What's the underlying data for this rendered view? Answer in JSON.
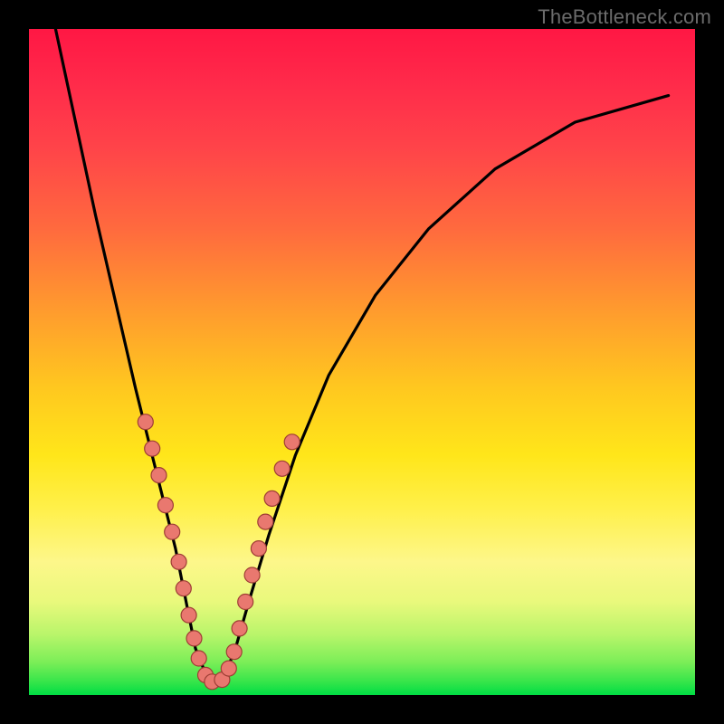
{
  "watermark": "TheBottleneck.com",
  "colors": {
    "frame": "#000000",
    "dot_fill": "#e9786f",
    "dot_stroke": "#9e3e35",
    "curve": "#000000"
  },
  "chart_data": {
    "type": "line",
    "title": "",
    "xlabel": "",
    "ylabel": "",
    "xlim": [
      0,
      100
    ],
    "ylim": [
      0,
      100
    ],
    "grid": false,
    "legend": false,
    "note": "V-shaped bottleneck curve; minimum near x≈27; dots mark sampled points along lower portion of curve",
    "series": [
      {
        "name": "curve",
        "x": [
          4,
          7,
          10,
          13,
          16,
          19,
          22,
          24,
          25,
          27,
          29,
          31,
          33,
          36,
          40,
          45,
          52,
          60,
          70,
          82,
          96
        ],
        "y": [
          100,
          86,
          72,
          59,
          46,
          34,
          22,
          12,
          7,
          2,
          2,
          7,
          14,
          24,
          36,
          48,
          60,
          70,
          79,
          86,
          90
        ]
      }
    ],
    "dots": [
      {
        "x": 17.5,
        "y": 41
      },
      {
        "x": 18.5,
        "y": 37
      },
      {
        "x": 19.5,
        "y": 33
      },
      {
        "x": 20.5,
        "y": 28.5
      },
      {
        "x": 21.5,
        "y": 24.5
      },
      {
        "x": 22.5,
        "y": 20
      },
      {
        "x": 23.2,
        "y": 16
      },
      {
        "x": 24.0,
        "y": 12
      },
      {
        "x": 24.8,
        "y": 8.5
      },
      {
        "x": 25.5,
        "y": 5.5
      },
      {
        "x": 26.5,
        "y": 3
      },
      {
        "x": 27.5,
        "y": 2
      },
      {
        "x": 29.0,
        "y": 2.3
      },
      {
        "x": 30.0,
        "y": 4
      },
      {
        "x": 30.8,
        "y": 6.5
      },
      {
        "x": 31.6,
        "y": 10
      },
      {
        "x": 32.5,
        "y": 14
      },
      {
        "x": 33.5,
        "y": 18
      },
      {
        "x": 34.5,
        "y": 22
      },
      {
        "x": 35.5,
        "y": 26
      },
      {
        "x": 36.5,
        "y": 29.5
      },
      {
        "x": 38.0,
        "y": 34
      },
      {
        "x": 39.5,
        "y": 38
      }
    ]
  }
}
